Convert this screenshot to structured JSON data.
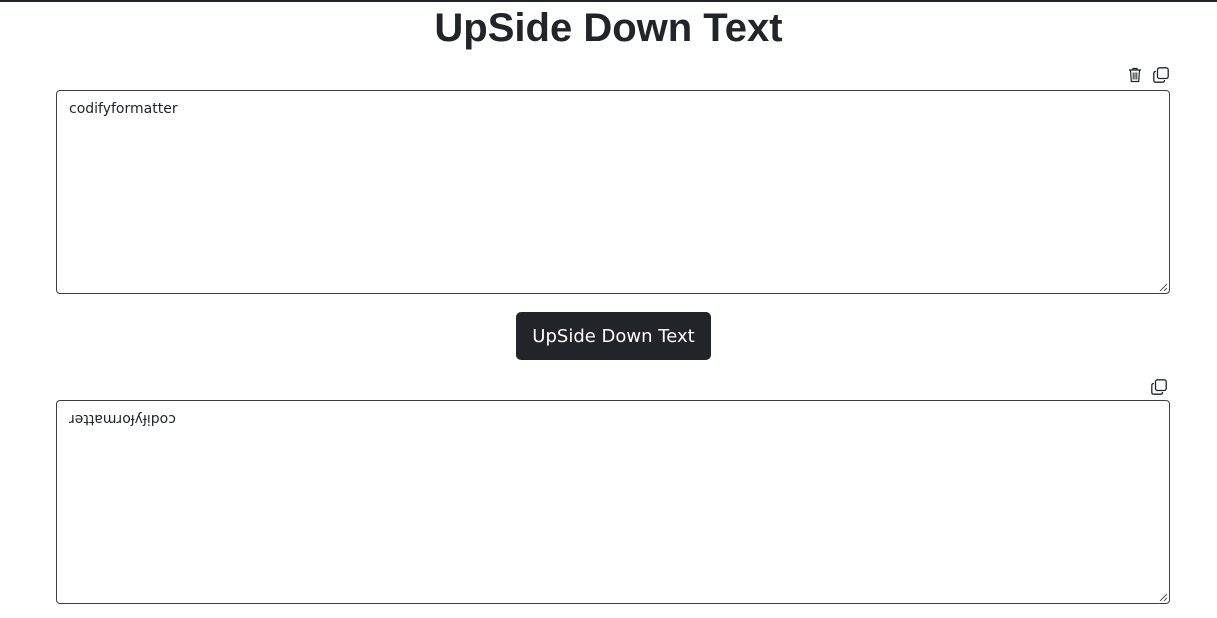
{
  "page": {
    "title": "UpSide Down Text"
  },
  "input": {
    "value": "codifyformatter",
    "tools": [
      {
        "icon": "trash-icon"
      },
      {
        "icon": "copy-icon"
      }
    ]
  },
  "convert": {
    "label": "UpSide Down Text"
  },
  "output": {
    "value": "ɹǝʇʇɐɯɹoɟʎɟᴉpoɔ",
    "tools": [
      {
        "icon": "copy-icon"
      }
    ]
  },
  "colors": {
    "text": "#212529",
    "button_bg": "#212529",
    "button_text": "#ffffff",
    "border": "#3d3f43"
  }
}
